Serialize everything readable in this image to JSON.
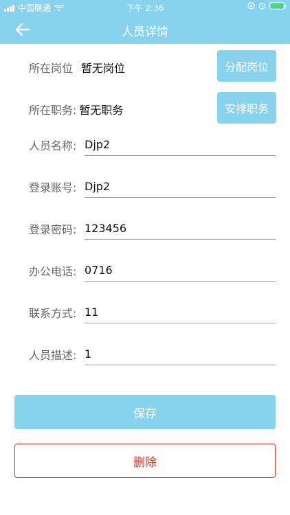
{
  "status_bar": {
    "carrier": "中国联通",
    "time": "下午 2:36"
  },
  "header": {
    "title": "人员详情",
    "back_icon": "arrow-left-icon",
    "background": "#87D3EE"
  },
  "position": {
    "label": "所在岗位",
    "value": "暂无岗位",
    "button_label": "分配岗位"
  },
  "duty": {
    "label": "所在职务:",
    "value": "暂无职务",
    "button_label": "安排职务"
  },
  "fields": {
    "name": {
      "label": "人员名称:",
      "value": "Djp2"
    },
    "account": {
      "label": "登录账号:",
      "value": "Djp2"
    },
    "password": {
      "label": "登录密码:",
      "value": "123456"
    },
    "office_phone": {
      "label": "办公电话:",
      "value": "0716"
    },
    "contact": {
      "label": "联系方式:",
      "value": "11"
    },
    "description": {
      "label": "人员描述:",
      "value": "1"
    }
  },
  "actions": {
    "save_label": "保存",
    "delete_label": "删除"
  },
  "colors": {
    "accent": "#87D3EE",
    "danger": "#D9362B"
  }
}
